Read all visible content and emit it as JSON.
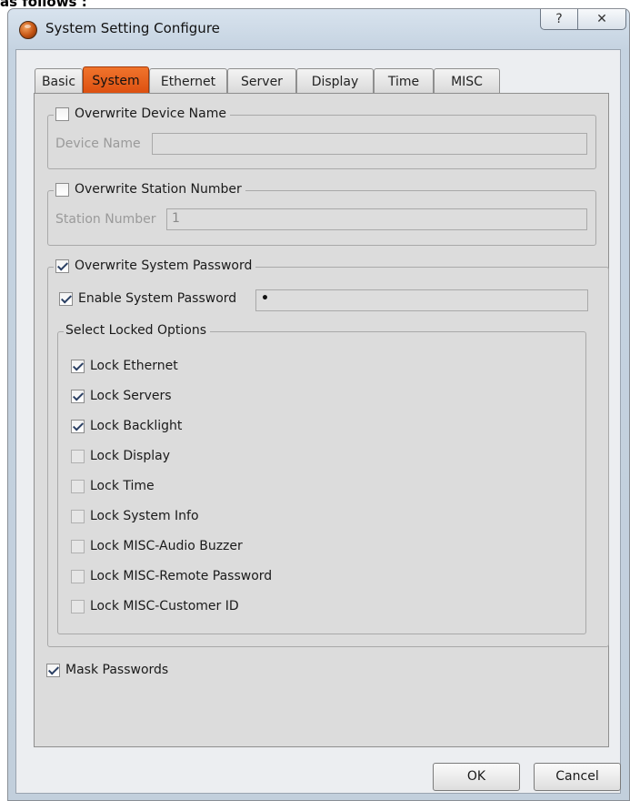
{
  "top_fragment": "as follows :",
  "window": {
    "title": "System Setting Configure",
    "help_glyph": "?",
    "close_glyph": "✕"
  },
  "tabs": [
    {
      "label": "Basic"
    },
    {
      "label": "System"
    },
    {
      "label": "Ethernet"
    },
    {
      "label": "Server"
    },
    {
      "label": "Display"
    },
    {
      "label": "Time"
    },
    {
      "label": "MISC"
    }
  ],
  "active_tab": "System",
  "device_name": {
    "checkbox_label": "Overwrite Device Name",
    "checked": false,
    "field_label": "Device Name",
    "value": ""
  },
  "station_number": {
    "checkbox_label": "Overwrite Station Number",
    "checked": false,
    "field_label": "Station Number",
    "value": "1"
  },
  "system_password": {
    "checkbox_label": "Overwrite System Password",
    "checked": true,
    "enable_label": "Enable System Password",
    "enable_checked": true,
    "password_value": "•"
  },
  "locked_options": {
    "legend": "Select Locked Options",
    "items": [
      {
        "label": "Lock Ethernet",
        "checked": true
      },
      {
        "label": "Lock Servers",
        "checked": true
      },
      {
        "label": "Lock Backlight",
        "checked": true
      },
      {
        "label": "Lock Display",
        "checked": false
      },
      {
        "label": "Lock Time",
        "checked": false
      },
      {
        "label": "Lock System Info",
        "checked": false
      },
      {
        "label": "Lock MISC-Audio Buzzer",
        "checked": false
      },
      {
        "label": "Lock MISC-Remote Password",
        "checked": false
      },
      {
        "label": "Lock MISC-Customer ID",
        "checked": false
      }
    ]
  },
  "mask_passwords": {
    "label": "Mask Passwords",
    "checked": true
  },
  "buttons": {
    "ok": "OK",
    "cancel": "Cancel"
  },
  "colors": {
    "active_tab": "#e8601e",
    "window_frame": "#c5d3e1",
    "panel": "#dcdcdc"
  }
}
